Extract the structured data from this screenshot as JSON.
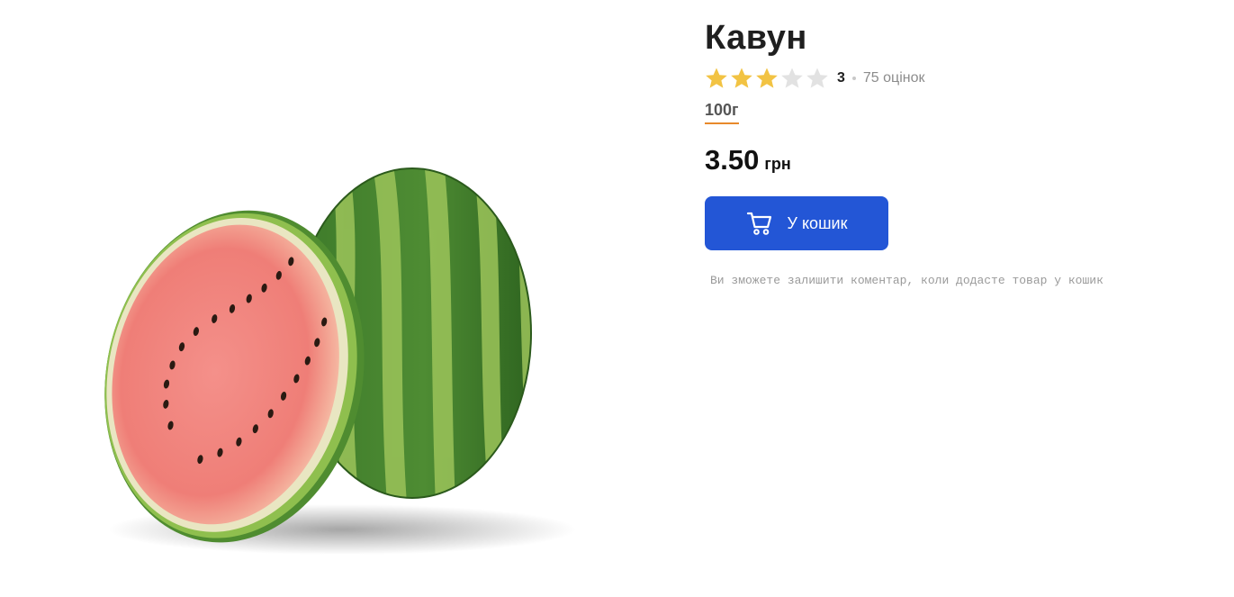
{
  "product": {
    "title": "Кавун",
    "image_alt": "watermelon-product-image",
    "rating": {
      "value": "3",
      "stars_filled": 3,
      "stars_total": 5,
      "reviews_label": "75 оцінок",
      "filled_color": "#f2c343",
      "empty_color": "#e2e2e2"
    },
    "weight_option": "100г",
    "price": {
      "value": "3.50",
      "currency": "грн"
    },
    "cart_button": {
      "label": "У кошик",
      "icon": "cart-icon",
      "color": "#2356d6"
    },
    "comment_note": "Ви зможете залишити коментар, коли додасте товар у кошик"
  },
  "colors": {
    "accent_underline": "#e8892b",
    "muted_text": "#8c8c8c"
  }
}
